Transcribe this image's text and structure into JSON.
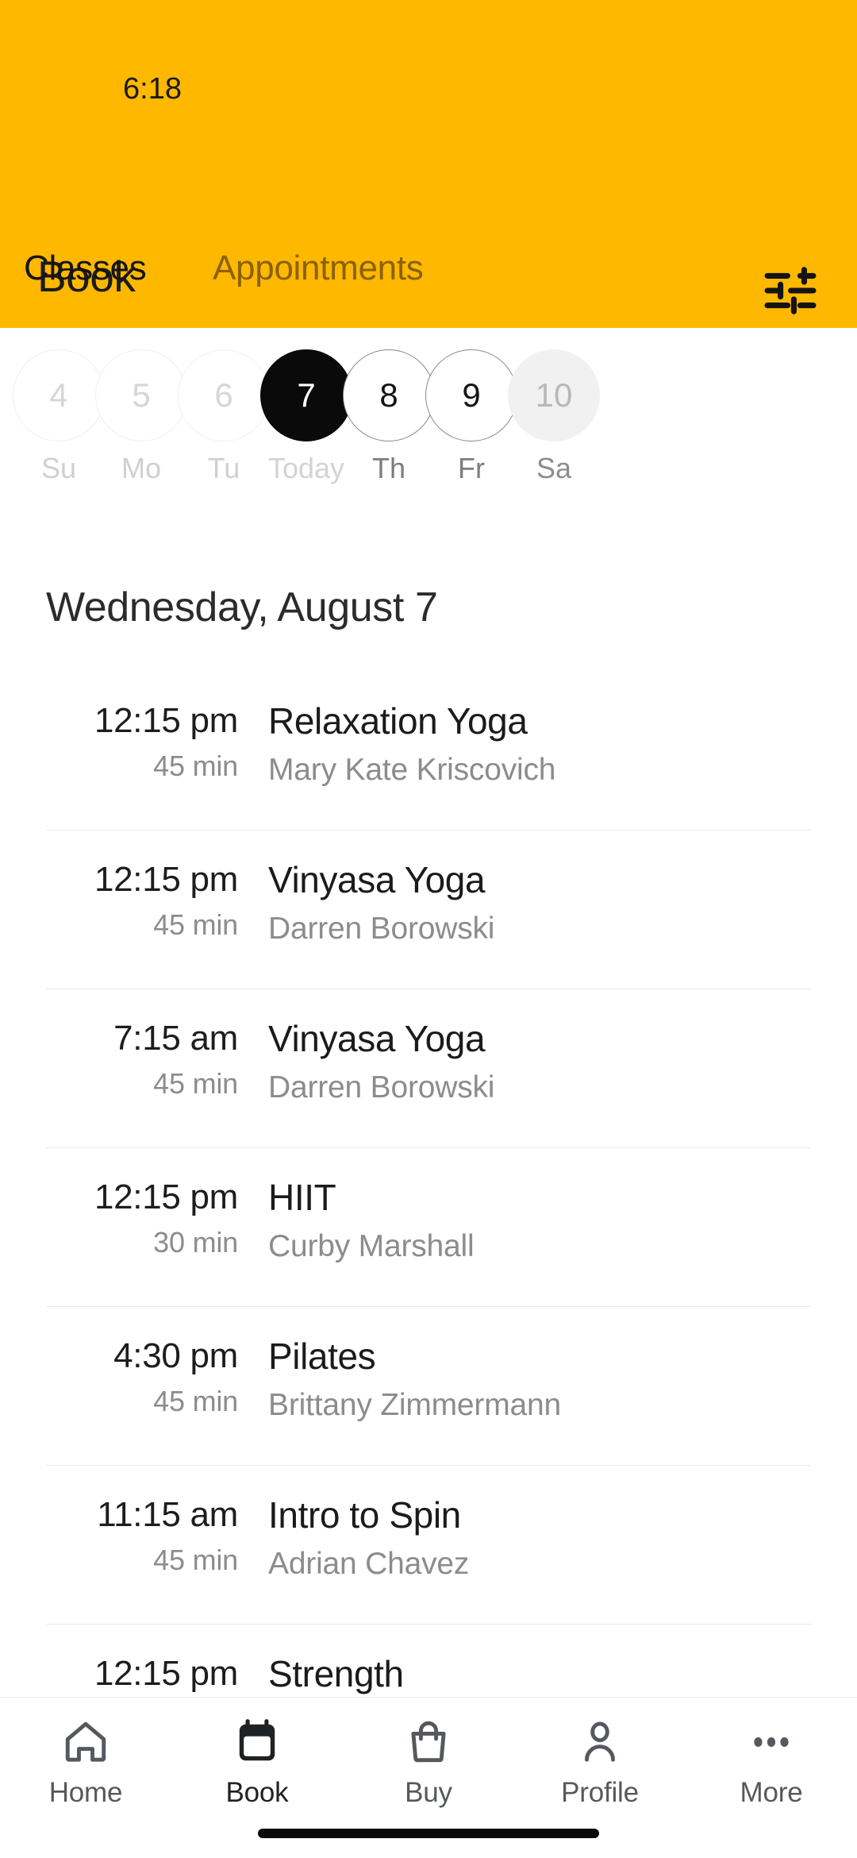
{
  "status_bar": {
    "time": "6:18"
  },
  "header": {
    "title": "Book",
    "filter_icon": "sliders-filter-icon",
    "background_color": "#ffb800",
    "tabs": [
      {
        "label": "Classes",
        "active": true
      },
      {
        "label": "Appointments",
        "active": false
      }
    ]
  },
  "date_strip": {
    "days": [
      {
        "num": "4",
        "dow": "Su",
        "state": "past"
      },
      {
        "num": "5",
        "dow": "Mo",
        "state": "past"
      },
      {
        "num": "6",
        "dow": "Tu",
        "state": "past"
      },
      {
        "num": "7",
        "dow": "Today",
        "state": "today"
      },
      {
        "num": "8",
        "dow": "Th",
        "state": "future"
      },
      {
        "num": "9",
        "dow": "Fr",
        "state": "future"
      },
      {
        "num": "10",
        "dow": "Sa",
        "state": "dim"
      }
    ]
  },
  "schedule": {
    "date_heading": "Wednesday, August 7",
    "classes": [
      {
        "time": "12:15 pm",
        "duration": "45 min",
        "name": "Relaxation Yoga",
        "coach": "Mary Kate Kriscovich"
      },
      {
        "time": "12:15 pm",
        "duration": "45 min",
        "name": "Vinyasa Yoga",
        "coach": "Darren Borowski"
      },
      {
        "time": "7:15 am",
        "duration": "45 min",
        "name": "Vinyasa Yoga",
        "coach": "Darren Borowski"
      },
      {
        "time": "12:15 pm",
        "duration": "30 min",
        "name": "HIIT",
        "coach": "Curby Marshall"
      },
      {
        "time": "4:30 pm",
        "duration": "45 min",
        "name": "Pilates",
        "coach": "Brittany Zimmermann"
      },
      {
        "time": "11:15 am",
        "duration": "45 min",
        "name": "Intro to Spin",
        "coach": "Adrian Chavez"
      },
      {
        "time": "12:15 pm",
        "duration": "",
        "name": "Strength",
        "coach": ""
      }
    ]
  },
  "bottom_nav": {
    "items": [
      {
        "label": "Home",
        "icon": "home-icon",
        "active": false
      },
      {
        "label": "Book",
        "icon": "calendar-icon",
        "active": true
      },
      {
        "label": "Buy",
        "icon": "shopping-bag-icon",
        "active": false
      },
      {
        "label": "Profile",
        "icon": "person-icon",
        "active": false
      },
      {
        "label": "More",
        "icon": "ellipsis-icon",
        "active": false
      }
    ]
  }
}
